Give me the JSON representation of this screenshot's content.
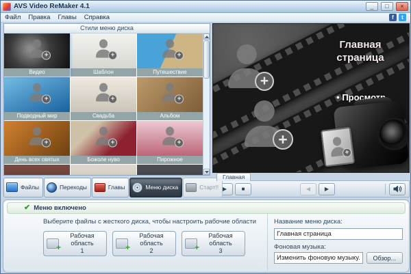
{
  "window": {
    "title": "AVS Video ReMaker 4.1",
    "controls": {
      "minimize": "_",
      "maximize": "□",
      "close": "×"
    }
  },
  "menubar": {
    "items": [
      "Файл",
      "Правка",
      "Главы",
      "Справка"
    ],
    "social": [
      "f",
      "t"
    ]
  },
  "styles_panel": {
    "header": "Стили меню диска",
    "items": [
      {
        "label": "Видео",
        "selected": true
      },
      {
        "label": "Шаблон",
        "selected": false
      },
      {
        "label": "Путешествие",
        "selected": false
      },
      {
        "label": "Подводный мир",
        "selected": false
      },
      {
        "label": "Свадьба",
        "selected": false
      },
      {
        "label": "Альбом",
        "selected": false
      },
      {
        "label": "День всех святых",
        "selected": false
      },
      {
        "label": "Божоле нуво",
        "selected": false
      },
      {
        "label": "Пирожное",
        "selected": false
      }
    ]
  },
  "preview": {
    "title": "Главная страница",
    "subtitle": "• Просмотр",
    "tab": "Главная"
  },
  "transport": {
    "play": "▶",
    "stop": "■",
    "prev": "◀",
    "next": "▶"
  },
  "toolbar": {
    "buttons": [
      {
        "label": "Файлы",
        "state": "normal"
      },
      {
        "label": "Переходы",
        "state": "normal"
      },
      {
        "label": "Главы",
        "state": "normal"
      },
      {
        "label": "Меню диска",
        "state": "active"
      },
      {
        "label": "Старт!!",
        "state": "disabled"
      }
    ]
  },
  "bottom": {
    "status": "Меню включено",
    "instruction": "Выберите файлы с жесткого диска, чтобы настроить рабочие области",
    "work_areas": [
      {
        "label": "Рабочая область",
        "number": "1"
      },
      {
        "label": "Рабочая область",
        "number": "2"
      },
      {
        "label": "Рабочая область",
        "number": "3"
      }
    ],
    "menu_name": {
      "label": "Название меню диска:",
      "value": "Главная страница"
    },
    "music": {
      "label": "Фоновая музыка:",
      "value": "Изменить фоновую музыку...",
      "browse": "Обзор..."
    }
  },
  "icons": {
    "check": "✔"
  },
  "colors": {
    "selection_accent": "#2f83d8",
    "thumb_label_bg": "#93a5a6",
    "status_green": "#2e9e2e"
  }
}
